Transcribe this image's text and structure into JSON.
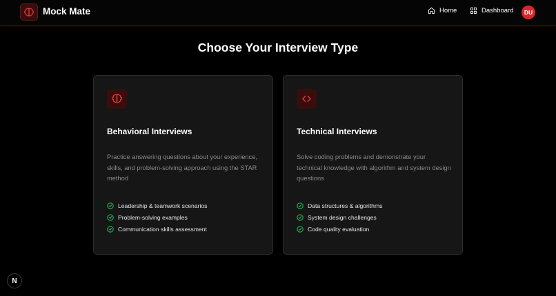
{
  "header": {
    "brand": "Mock Mate",
    "nav": [
      {
        "label": "Home",
        "icon": "home-icon"
      },
      {
        "label": "Dashboard",
        "icon": "grid-icon"
      }
    ],
    "avatar_initials": "DU"
  },
  "main": {
    "title": "Choose Your Interview Type",
    "cards": [
      {
        "icon": "brain-icon",
        "title": "Behavioral Interviews",
        "description": "Practice answering questions about your experience, skills, and problem-solving approach using the STAR method",
        "features": [
          "Leadership & teamwork scenarios",
          "Problem-solving examples",
          "Communication skills assessment"
        ]
      },
      {
        "icon": "code-icon",
        "title": "Technical Interviews",
        "description": "Solve coding problems and demonstrate your technical knowledge with algorithm and system design questions",
        "features": [
          "Data structures & algorithms",
          "System design challenges",
          "Code quality evaluation"
        ]
      }
    ]
  },
  "colors": {
    "accent": "#d7262c",
    "check": "#22c55e",
    "card_bg": "#161616",
    "page_bg": "#000000"
  },
  "dev_badge": {
    "letter": "N",
    "icon": "nextjs-icon"
  }
}
